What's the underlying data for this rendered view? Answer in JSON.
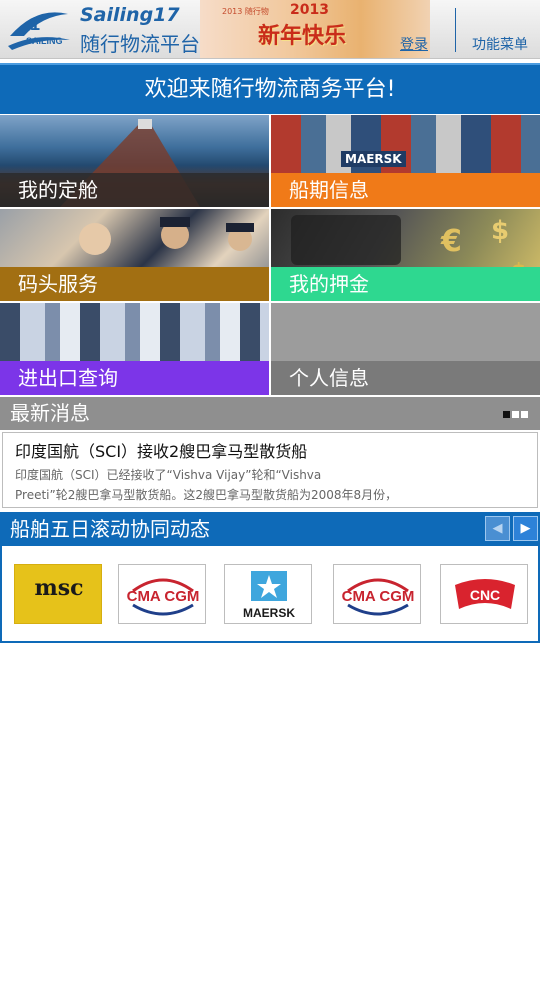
{
  "header": {
    "brand_en": "Sailing17",
    "brand_cn": "随行物流平台",
    "login": "登录",
    "menu": "功能菜单",
    "banner_text": "新年快乐",
    "banner_year": "2013",
    "banner_small": "2013 随行物"
  },
  "welcome": "欢迎来随行物流商务平台!",
  "tiles": {
    "ship": "我的定舱",
    "schedule": "船期信息",
    "dock": "码头服务",
    "deposit": "我的押金",
    "import_export": "进出口查询",
    "profile": "个人信息",
    "container_brand": "MAERSK"
  },
  "news": {
    "heading": "最新消息",
    "title": "印度国航（SCI）接收2艘巴拿马型散货船",
    "line1": "印度国航（SCI）已经接收了“Vishva Vijay”轮和“Vishva",
    "line2": "Preeti”轮2艘巴拿马型散货船。这2艘巴拿马型散货船为2008年8月份，"
  },
  "dynamics": {
    "heading": "船舶五日滚动协同动态",
    "prev": "◀",
    "next": "▶",
    "logos": [
      "msc",
      "CMA CGM",
      "MAERSK",
      "CMA CGM",
      "CNC"
    ]
  },
  "colors": {
    "brand_blue": "#0e6ab8",
    "ship_label": "#3c3c3c",
    "schedule_label": "#f07a18",
    "dock_label": "#a26f12",
    "deposit_label": "#2ed890",
    "io_label": "#7c35e8",
    "profile_label": "#7a7a7a"
  }
}
